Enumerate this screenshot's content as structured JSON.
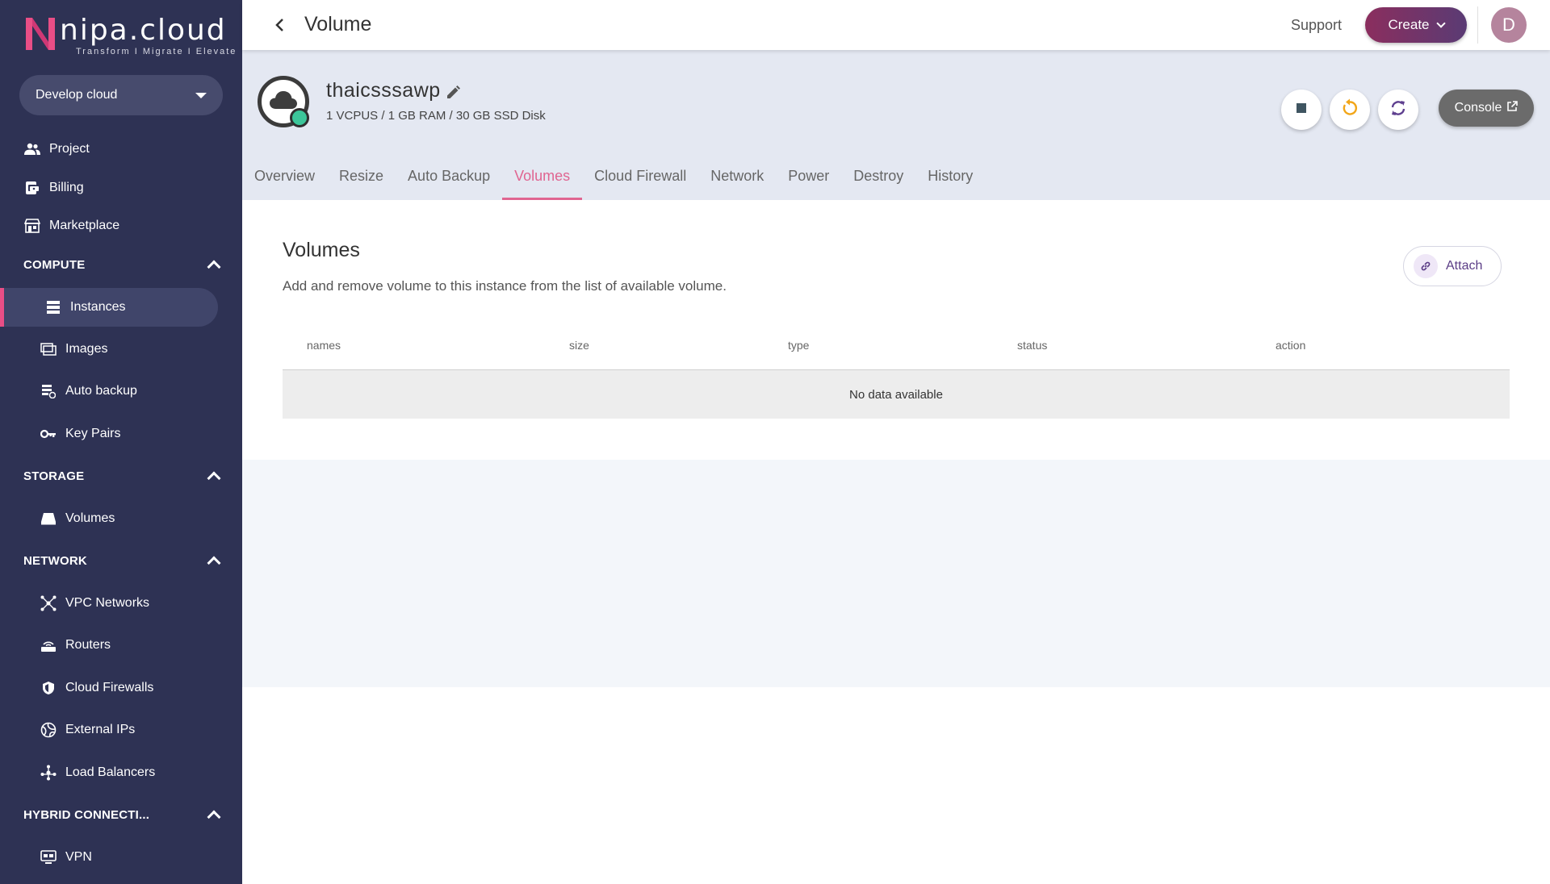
{
  "brand": {
    "name": "nipa.cloud",
    "tagline": "Transform  I  Migrate  I  Elevate",
    "accent": "#e94e86",
    "sidebar_bg": "#2e3254"
  },
  "project_selector": {
    "value": "Develop cloud"
  },
  "sidebar": {
    "top_items": [
      {
        "label": "Project",
        "icon": "users-icon"
      },
      {
        "label": "Billing",
        "icon": "billing-icon"
      },
      {
        "label": "Marketplace",
        "icon": "store-icon"
      }
    ],
    "sections": {
      "compute": {
        "label": "COMPUTE",
        "items": [
          "Instances",
          "Images",
          "Auto backup",
          "Key Pairs"
        ]
      },
      "storage": {
        "label": "STORAGE",
        "items": [
          "Volumes"
        ]
      },
      "network": {
        "label": "NETWORK",
        "items": [
          "VPC Networks",
          "Routers",
          "Cloud Firewalls",
          "External IPs",
          "Load Balancers"
        ]
      },
      "hybrid": {
        "label": "HYBRID CONNECTI...",
        "items": [
          "VPN"
        ]
      }
    },
    "active_item": "Instances"
  },
  "topbar": {
    "title": "Volume",
    "support_label": "Support",
    "create_label": "Create",
    "avatar_initial": "D"
  },
  "instance": {
    "name": "thaicsssawp",
    "spec": "1 VCPUS / 1 GB RAM / 30 GB SSD Disk",
    "status_color": "#3cc69a",
    "console_label": "Console",
    "tabs": [
      "Overview",
      "Resize",
      "Auto Backup",
      "Volumes",
      "Cloud Firewall",
      "Network",
      "Power",
      "Destroy",
      "History"
    ],
    "active_tab": "Volumes"
  },
  "volumes": {
    "title": "Volumes",
    "description": "Add and remove volume to this instance from the list of available volume.",
    "attach_label": "Attach",
    "columns": [
      "names",
      "size",
      "type",
      "status",
      "action"
    ],
    "empty_text": "No data available"
  }
}
